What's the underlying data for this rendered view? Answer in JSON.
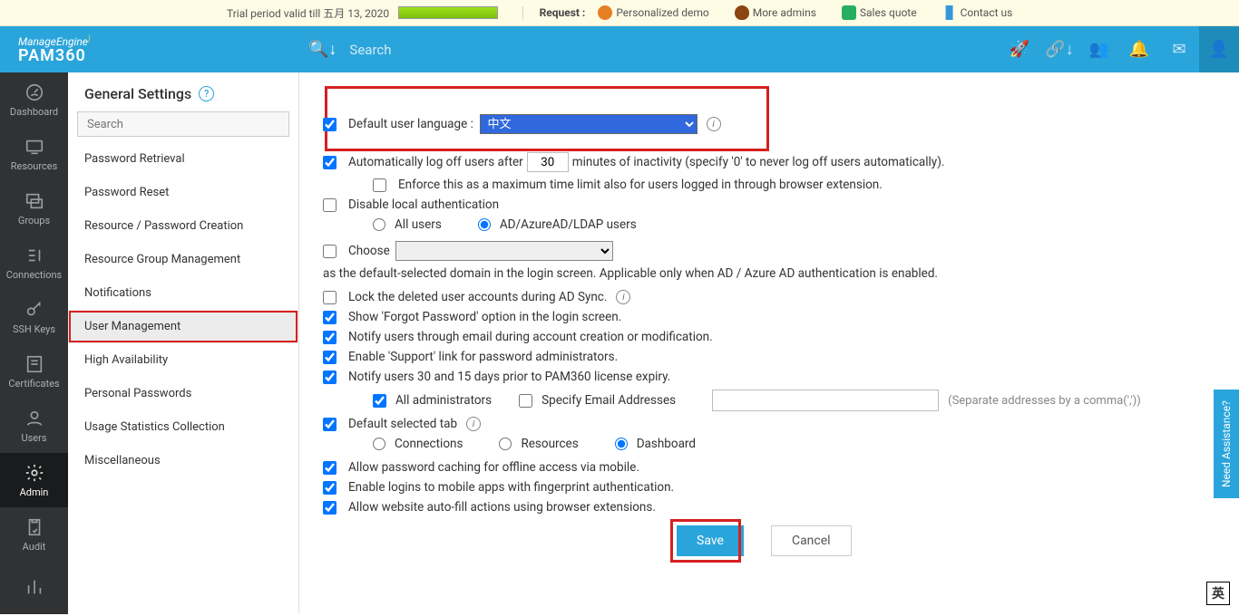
{
  "trial": {
    "text": "Trial period valid till 五月 13, 2020",
    "request_label": "Request :",
    "links": {
      "demo": "Personalized demo",
      "admins": "More admins",
      "quote": "Sales quote",
      "contact": "Contact us"
    }
  },
  "header": {
    "logo_top": "ManageEngine",
    "logo_name": "PAM360",
    "search_placeholder": "Search"
  },
  "nav": {
    "items": [
      {
        "label": "Dashboard"
      },
      {
        "label": "Resources"
      },
      {
        "label": "Groups"
      },
      {
        "label": "Connections"
      },
      {
        "label": "SSH Keys"
      },
      {
        "label": "Certificates"
      },
      {
        "label": "Users"
      },
      {
        "label": "Admin"
      },
      {
        "label": "Audit"
      },
      {
        "label": ""
      }
    ],
    "active_index": 7
  },
  "settings": {
    "title": "General Settings",
    "search_placeholder": "Search",
    "items": [
      "Password Retrieval",
      "Password Reset",
      "Resource / Password Creation",
      "Resource Group Management",
      "Notifications",
      "User Management",
      "High Availability",
      "Personal Passwords",
      "Usage Statistics Collection",
      "Miscellaneous"
    ],
    "active_index": 5
  },
  "form": {
    "default_lang_label": "Default user language :",
    "default_lang_value": "中文",
    "auto_logoff_pre": "Automatically log off users after",
    "auto_logoff_value": "30",
    "auto_logoff_post": "minutes of inactivity (specify '0' to never log off users automatically).",
    "enforce_ext": "Enforce this as a maximum time limit also for users logged in through browser extension.",
    "disable_local_auth": "Disable local authentication",
    "all_users": "All users",
    "ad_users": "AD/AzureAD/LDAP users",
    "choose": "Choose",
    "domain_note": "as the default-selected domain in the login screen. Applicable only when AD / Azure AD authentication is enabled.",
    "lock_deleted": "Lock the deleted user accounts during AD Sync.",
    "forgot_pwd": "Show 'Forgot Password' option in the login screen.",
    "notify_email": "Notify users through email during account creation or modification.",
    "enable_support": "Enable 'Support' link for password administrators.",
    "notify_expiry": "Notify users 30 and 15 days prior to PAM360 license expiry.",
    "all_admins": "All administrators",
    "spec_email": "Specify Email Addresses",
    "sep_note": "(Separate addresses by a comma(','))",
    "default_tab": "Default selected tab",
    "tab_conn": "Connections",
    "tab_res": "Resources",
    "tab_dash": "Dashboard",
    "allow_cache": "Allow password caching for offline access via mobile.",
    "enable_fp": "Enable logins to mobile apps with fingerprint authentication.",
    "allow_autofill": "Allow website auto-fill actions using browser extensions.",
    "save": "Save",
    "cancel": "Cancel"
  },
  "assist": "Need Assistance?",
  "ime": "英"
}
